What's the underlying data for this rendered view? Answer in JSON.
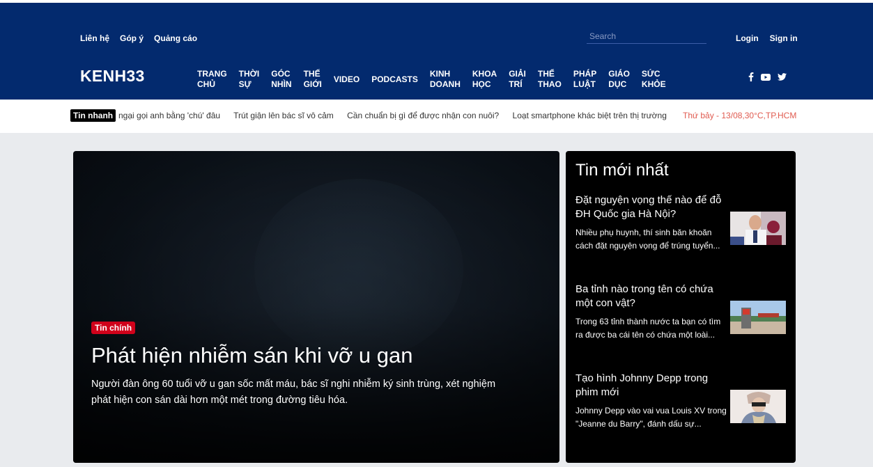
{
  "header": {
    "util_links": [
      "Liên hệ",
      "Góp ý",
      "Quảng cáo"
    ],
    "search_placeholder": "Search",
    "login": "Login",
    "signin": "Sign in",
    "logo": "KENH33",
    "nav": [
      "Trang\nchủ",
      "Thời\nsự",
      "Góc\nnhìn",
      "Thế\ngiới",
      "Video",
      "Podcasts",
      "Kinh\ndoanh",
      "Khoa\nhọc",
      "Giải\ntrí",
      "Thể\nthao",
      "Pháp\nluật",
      "Giáo\ndục",
      "Sức\nkhỏe"
    ],
    "social_icons": [
      "facebook-icon",
      "youtube-icon",
      "twitter-icon"
    ]
  },
  "ticker": {
    "label": "Tin nhanh",
    "items": [
      "ngại gọi anh bằng 'chú' đâu",
      "Trút giận lên bác sĩ vô cảm",
      "Cần chuẩn bị gì để được nhận con nuôi?",
      "Loạt smartphone khác biệt trên thị trường"
    ],
    "date": "Thứ bảy - 13/08,30°C,TP.HCM"
  },
  "hero": {
    "badge": "Tin chính",
    "title": "Phát hiện nhiễm sán khi vỡ u gan",
    "description": "Người đàn ông 60 tuổi vỡ u gan sốc mất máu, bác sĩ nghi nhiễm ký sinh trùng, xét nghiệm phát hiện con sán dài hơn một mét trong đường tiêu hóa."
  },
  "latest": {
    "title": "Tin mới nhất",
    "items": [
      {
        "title": "Đặt nguyện vọng thế nào để đỗ ĐH Quốc gia Hà Nội?",
        "desc": "Nhiều phụ huynh, thí sinh băn khoăn cách đặt nguyện vọng để trúng tuyển..."
      },
      {
        "title": "Ba tỉnh nào trong tên có chứa một con vật?",
        "desc": "Trong 63 tỉnh thành nước ta bạn có tìm ra được ba cái tên có chứa một loài..."
      },
      {
        "title": "Tạo hình Johnny Depp trong phim mới",
        "desc": "Johnny Depp vào vai vua Louis XV trong \"Jeanne du Barry\", đánh dấu sự..."
      }
    ]
  },
  "colors": {
    "header_bg": "#032a6e",
    "accent_red": "#d0021b",
    "date_color": "#e05a4f"
  }
}
